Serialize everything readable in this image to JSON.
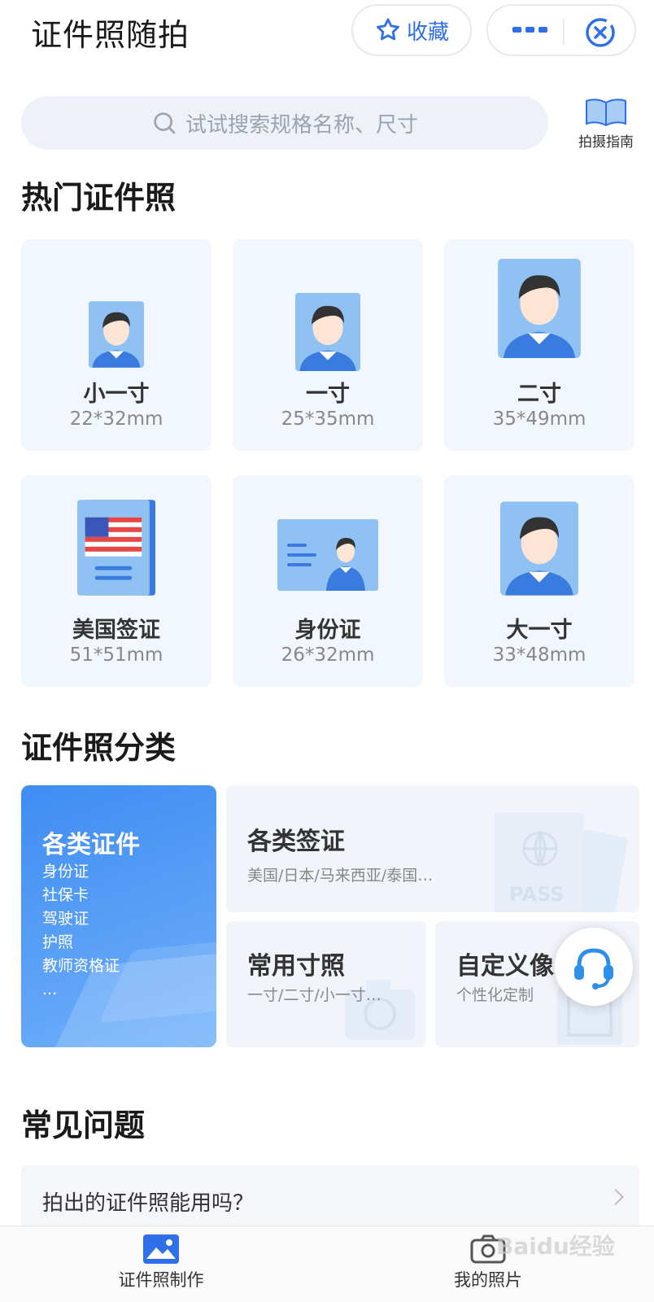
{
  "header": {
    "title": "证件照随拍",
    "favorite_label": "收藏"
  },
  "search": {
    "placeholder": "试试搜索规格名称、尺寸",
    "guide_label": "拍摄指南"
  },
  "hot": {
    "title": "热门证件照",
    "items": [
      {
        "name": "小一寸",
        "size": "22*32mm"
      },
      {
        "name": "一寸",
        "size": "25*35mm"
      },
      {
        "name": "二寸",
        "size": "35*49mm"
      },
      {
        "name": "美国签证",
        "size": "51*51mm"
      },
      {
        "name": "身份证",
        "size": "26*32mm"
      },
      {
        "name": "大一寸",
        "size": "33*48mm"
      }
    ]
  },
  "category": {
    "title": "证件照分类",
    "left": {
      "title": "各类证件",
      "items": [
        "身份证",
        "社保卡",
        "驾驶证",
        "护照",
        "教师资格证",
        "..."
      ]
    },
    "visa": {
      "title": "各类签证",
      "subtitle": "美国/日本/马来西亚/泰国…",
      "watermark": "PASS"
    },
    "common": {
      "title": "常用寸照",
      "subtitle": "一寸/二寸/小一寸…"
    },
    "custom": {
      "title": "自定义像",
      "subtitle": "个性化定制"
    }
  },
  "faq": {
    "title": "常见问题",
    "items": [
      {
        "question": "拍出的证件照能用吗？"
      }
    ]
  },
  "bottom_nav": [
    {
      "label": "证件照制作"
    },
    {
      "label": "我的照片"
    }
  ],
  "watermark": "Baidu经验",
  "colors": {
    "accent": "#2f6fe8",
    "card_bg": "#f2f7ff",
    "portrait_bg": "#8fc1f3"
  }
}
